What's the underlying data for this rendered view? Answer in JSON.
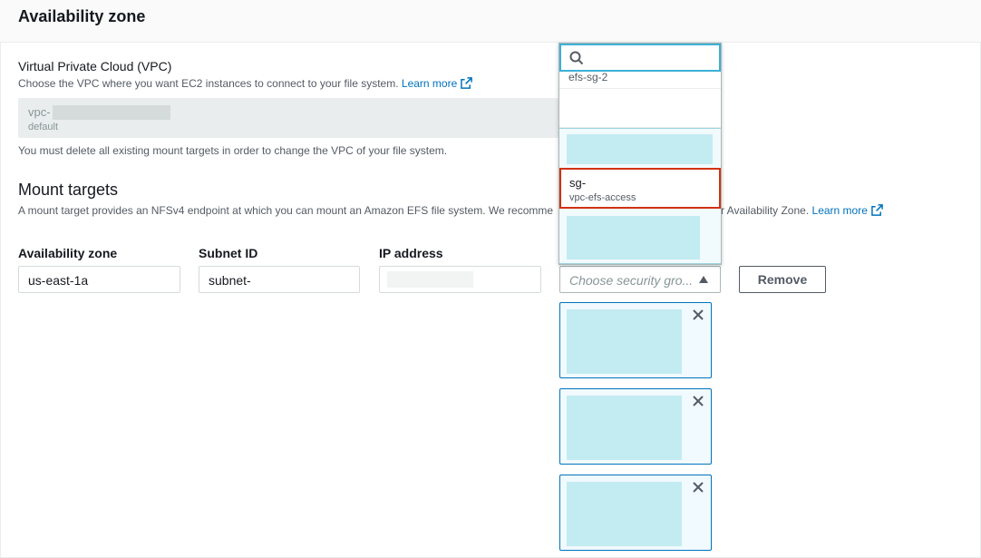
{
  "section": {
    "title": "Availability zone"
  },
  "vpc": {
    "label": "Virtual Private Cloud (VPC)",
    "description": "Choose the VPC where you want EC2 instances to connect to your file system.",
    "learn_more": "Learn more",
    "value_prefix": "vpc-",
    "value_sub": "default",
    "note": "You must delete all existing mount targets in order to change the VPC of your file system."
  },
  "mount_targets": {
    "title": "Mount targets",
    "description": "A mount target provides an NFSv4 endpoint at which you can mount an Amazon EFS file system. We recomme",
    "description_tail": "r Availability Zone.",
    "learn_more": "Learn more",
    "columns": {
      "availability_zone": "Availability zone",
      "subnet_id": "Subnet ID",
      "ip_address": "IP address"
    },
    "row": {
      "availability_zone": "us-east-1a",
      "subnet_id": "subnet-",
      "security_group_placeholder": "Choose security gro...",
      "remove_label": "Remove"
    }
  },
  "dropdown": {
    "clipped_option": "efs-sg-2",
    "selected_option": {
      "id": "sg-",
      "name": "vpc-efs-access"
    }
  },
  "icons": {
    "search": "search-icon",
    "external_link": "external-link-icon",
    "close": "close-icon",
    "caret_up": "caret-up-icon"
  },
  "colors": {
    "link": "#0073bb",
    "search_focus": "#3cb0d6",
    "selected_border": "#d13212",
    "token_border": "#0073bb",
    "redaction": "#c3ebf2"
  }
}
